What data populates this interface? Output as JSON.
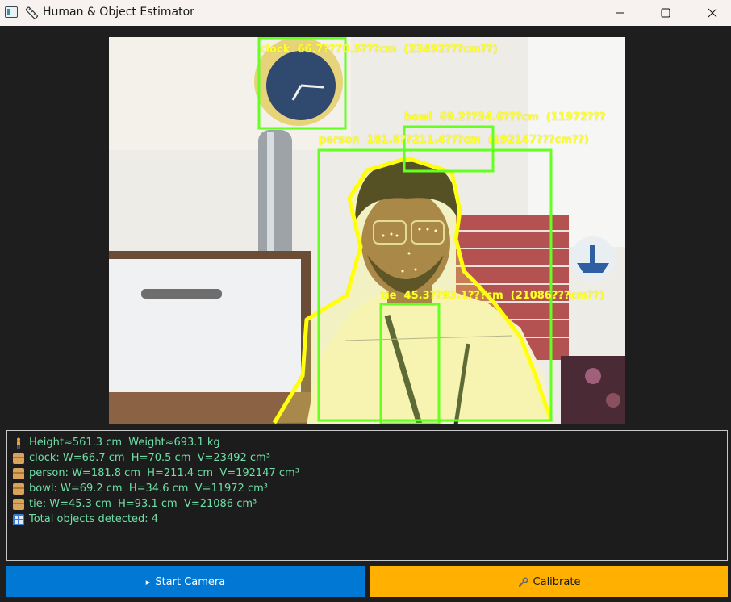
{
  "window": {
    "title": "Human & Object Estimator",
    "minimize_icon": "minimize-icon",
    "maximize_icon": "maximize-icon",
    "close_icon": "close-icon"
  },
  "video": {
    "detections": [
      {
        "label": "clock  66.7??70.5???cm  (23492???cm??)",
        "box_color": "#66ff22"
      },
      {
        "label": "bowl  69.2??34.6???cm  (11972???",
        "box_color": "#66ff22"
      },
      {
        "label": "person  181.8??211.4???cm  (192147???cm??)",
        "box_color": "#66ff22"
      },
      {
        "label": "tie  45.3??93.1???cm  (21086???cm??)",
        "box_color": "#66ff22"
      }
    ],
    "label_color": "#ffff2a",
    "outline_color": "#ffff00"
  },
  "info": {
    "lines": [
      {
        "icon": "person-icon",
        "text": "Height≈561.3 cm  Weight≈693.1 kg"
      },
      {
        "icon": "package-icon",
        "text": "clock: W=66.7 cm  H=70.5 cm  V=23492 cm³"
      },
      {
        "icon": "package-icon",
        "text": "person: W=181.8 cm  H=211.4 cm  V=192147 cm³"
      },
      {
        "icon": "package-icon",
        "text": "bowl: W=69.2 cm  H=34.6 cm  V=11972 cm³"
      },
      {
        "icon": "package-icon",
        "text": "tie: W=45.3 cm  H=93.1 cm  V=21086 cm³"
      },
      {
        "icon": "numbers-icon",
        "text": "Total objects detected: 4"
      }
    ],
    "text_color": "#6ee0a6"
  },
  "buttons": {
    "start": {
      "label": "Start Camera",
      "icon": "play-icon",
      "color": "#0078d4"
    },
    "calibrate": {
      "label": "Calibrate",
      "icon": "wrench-icon",
      "color": "#ffb000"
    }
  }
}
